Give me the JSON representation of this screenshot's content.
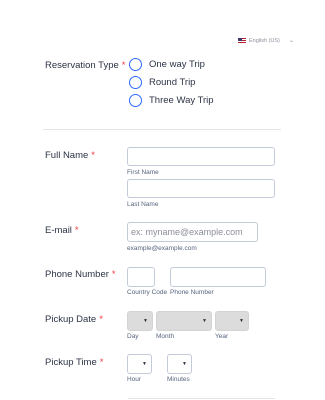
{
  "header": {
    "language": "English (US)"
  },
  "reservation": {
    "label": "Reservation Type",
    "required_mark": "*",
    "options": [
      "One way Trip",
      "Round Trip",
      "Three Way Trip"
    ]
  },
  "full_name": {
    "label": "Full Name",
    "required_mark": "*",
    "first_label": "First Name",
    "last_label": "Last Name"
  },
  "email": {
    "label": "E-mail",
    "required_mark": "*",
    "placeholder": "ex: myname@example.com",
    "sublabel": "example@example.com"
  },
  "phone": {
    "label": "Phone Number",
    "required_mark": "*",
    "country_label": "Country Code",
    "number_label": "Phone Number"
  },
  "pickup_date": {
    "label": "Pickup Date",
    "required_mark": "*",
    "day_label": "Day",
    "month_label": "Month",
    "year_label": "Year"
  },
  "pickup_time": {
    "label": "Pickup Time",
    "required_mark": "*",
    "hour_label": "Hour",
    "minutes_label": "Minutes"
  },
  "colors": {
    "accent": "#2e69ff",
    "required": "#f23a3c",
    "text": "#2c3345",
    "border": "#c3cad8"
  }
}
